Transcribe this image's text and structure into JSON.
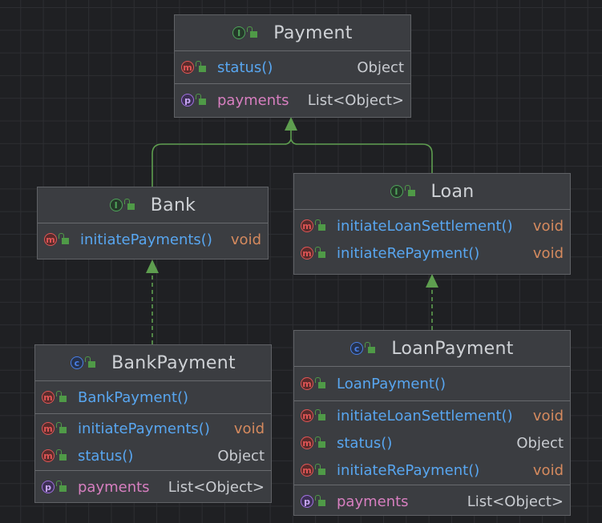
{
  "edge_color": "#5e9e4f",
  "classes": {
    "payment": {
      "kind": "interface",
      "name": "Payment",
      "methods": [
        {
          "name": "status()",
          "type": "Object"
        }
      ],
      "fields": [
        {
          "name": "payments",
          "type": "List<Object>"
        }
      ]
    },
    "bank": {
      "kind": "interface",
      "name": "Bank",
      "methods": [
        {
          "name": "initiatePayments()",
          "type": "void"
        }
      ]
    },
    "loan": {
      "kind": "interface",
      "name": "Loan",
      "methods": [
        {
          "name": "initiateLoanSettlement()",
          "type": "void"
        },
        {
          "name": "initiateRePayment()",
          "type": "void"
        }
      ]
    },
    "bankpayment": {
      "kind": "class",
      "name": "BankPayment",
      "constructors": [
        {
          "name": "BankPayment()"
        }
      ],
      "methods": [
        {
          "name": "initiatePayments()",
          "type": "void"
        },
        {
          "name": "status()",
          "type": "Object"
        }
      ],
      "fields": [
        {
          "name": "payments",
          "type": "List<Object>"
        }
      ]
    },
    "loanpayment": {
      "kind": "class",
      "name": "LoanPayment",
      "constructors": [
        {
          "name": "LoanPayment()"
        }
      ],
      "methods": [
        {
          "name": "initiateLoanSettlement()",
          "type": "void"
        },
        {
          "name": "status()",
          "type": "Object"
        },
        {
          "name": "initiateRePayment()",
          "type": "void"
        }
      ],
      "fields": [
        {
          "name": "payments",
          "type": "List<Object>"
        }
      ]
    }
  },
  "badges": {
    "interface": "I",
    "class": "c",
    "method": "m",
    "property": "p"
  },
  "relations": [
    {
      "from": "Bank",
      "to": "Payment",
      "type": "extends"
    },
    {
      "from": "Loan",
      "to": "Payment",
      "type": "extends"
    },
    {
      "from": "BankPayment",
      "to": "Bank",
      "type": "implements"
    },
    {
      "from": "LoanPayment",
      "to": "Loan",
      "type": "implements"
    }
  ]
}
